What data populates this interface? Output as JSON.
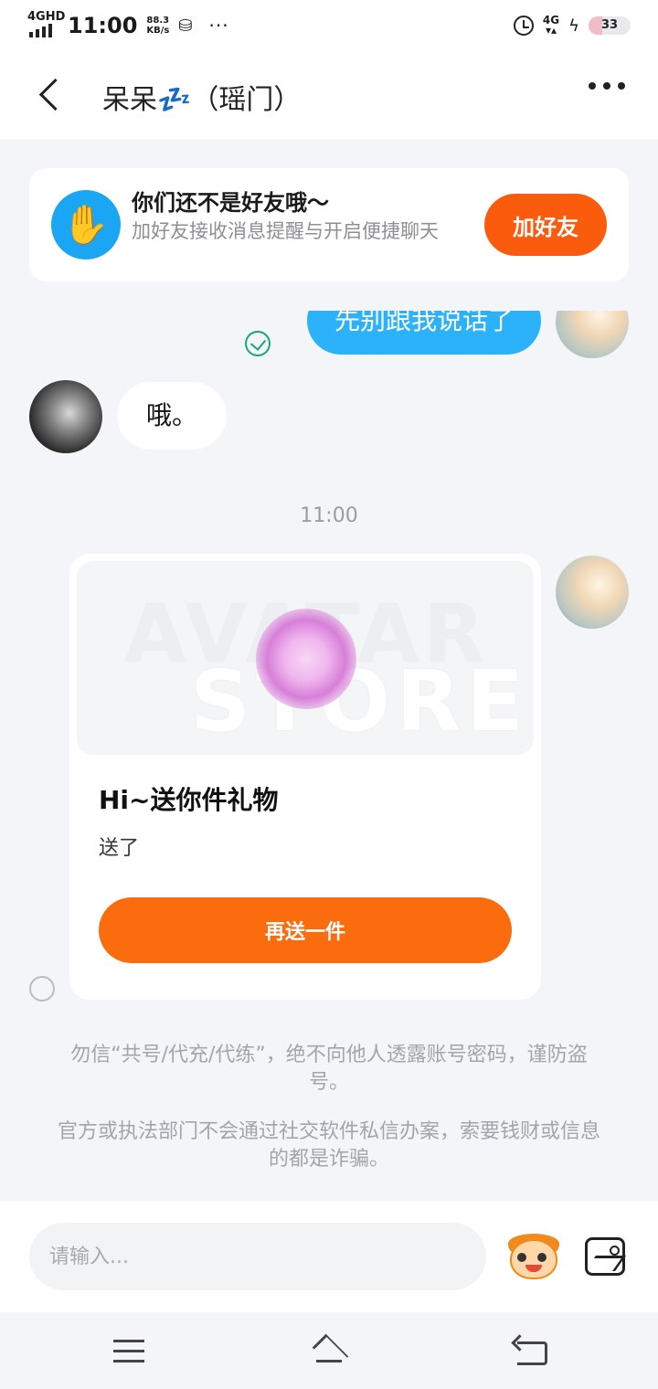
{
  "status_bar": {
    "network": "4GHD",
    "time": "11:00",
    "speed_value": "88.3",
    "speed_unit": "KB/s",
    "overflow": "···",
    "right_network": "4G",
    "battery": "33",
    "battery_level": 0.33
  },
  "header": {
    "title": "呆呆💤（瑶门）"
  },
  "friend_banner": {
    "heading": "你们还不是好友哦～",
    "description": "加好友接收消息提醒与开启便捷聊天",
    "button_label": "加好友",
    "icon": "wave-hand-icon"
  },
  "messages": {
    "outgoing_partial": "先别跟我说话了",
    "incoming": "哦。",
    "timestamp": "11:00"
  },
  "gift_card": {
    "title": "Hi~送你件礼物",
    "subtitle": "送了",
    "button_label": "再送一件",
    "watermark_top": "AVATAR",
    "watermark_bottom": "STORE"
  },
  "notices": [
    "勿信“共号/代充/代练”，绝不向他人透露账号密码，谨防盗号。",
    "官方或执法部门不会通过社交软件私信办案，索要钱财或信息的都是诈骗。"
  ],
  "input_bar": {
    "placeholder": "请输入..."
  },
  "colors": {
    "accent_orange": "#fb5b0d",
    "bubble_blue": "#2cb2fb",
    "read_green": "#1aa671"
  }
}
